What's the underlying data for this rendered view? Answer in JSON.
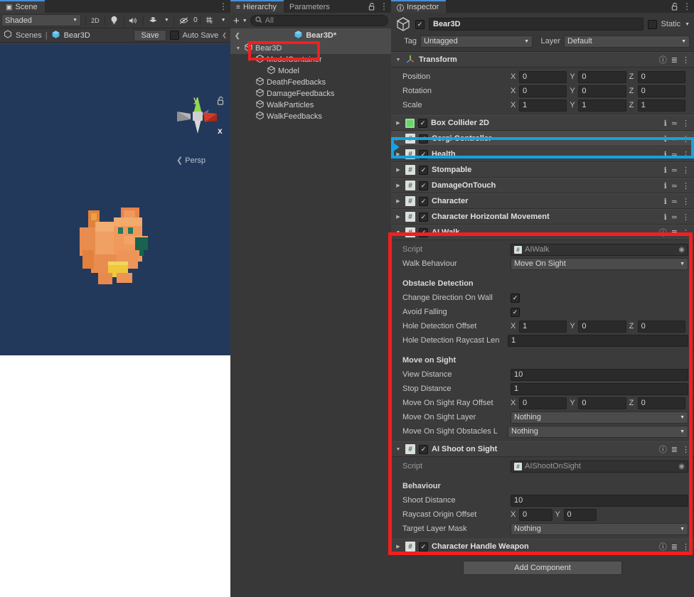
{
  "scene": {
    "tab_label": "Scene",
    "tab_icon": "grid-icon",
    "kebab": "⋮",
    "toolbar": {
      "shading_mode": "Shaded",
      "mode_2d": "2D",
      "lighting_icon": "lightbulb-icon",
      "audio_icon": "speaker-icon",
      "fx_icon": "effects-icon",
      "hidden_count": "0",
      "grid_icon": "grid-snap-icon"
    },
    "breadcrumb": {
      "scenes_label": "Scenes",
      "separator": "|",
      "scene_name": "Bear3D",
      "save_label": "Save",
      "auto_save_label": "Auto Save"
    },
    "gizmo": {
      "axis_y": "y",
      "axis_x": "x",
      "perspective_label": "Persp",
      "lock_icon": "lock-open-icon"
    },
    "background_color": "#23395b"
  },
  "hierarchy": {
    "tab_label": "Hierarchy",
    "tab_parameters": "Parameters",
    "lock_icon": "lock-open-icon",
    "kebab": "⋮",
    "create_label": "+",
    "search_placeholder": "All",
    "scene_row": "Bear3D*",
    "items": [
      {
        "label": "Bear3D",
        "indent": 0,
        "expanded": true,
        "selected": true
      },
      {
        "label": "ModelContainer",
        "indent": 1,
        "expanded": true,
        "selected": false
      },
      {
        "label": "Model",
        "indent": 2,
        "expanded": false,
        "selected": false
      },
      {
        "label": "DeathFeedbacks",
        "indent": 1,
        "expanded": false,
        "selected": false
      },
      {
        "label": "DamageFeedbacks",
        "indent": 1,
        "expanded": false,
        "selected": false
      },
      {
        "label": "WalkParticles",
        "indent": 1,
        "expanded": false,
        "selected": false
      },
      {
        "label": "WalkFeedbacks",
        "indent": 1,
        "expanded": false,
        "selected": false
      }
    ]
  },
  "inspector": {
    "tab_label": "Inspector",
    "lock_icon": "lock-open-icon",
    "kebab": "⋮",
    "object_name": "Bear3D",
    "static_label": "Static",
    "tag_label": "Tag",
    "tag_value": "Untagged",
    "layer_label": "Layer",
    "layer_value": "Default",
    "transform": {
      "title": "Transform",
      "rows": [
        {
          "label": "Position",
          "x": "0",
          "y": "0",
          "z": "0"
        },
        {
          "label": "Rotation",
          "x": "0",
          "y": "0",
          "z": "0"
        },
        {
          "label": "Scale",
          "x": "1",
          "y": "1",
          "z": "1"
        }
      ]
    },
    "components": [
      {
        "name": "Box Collider 2D",
        "icon": "collider-icon",
        "enabled": true,
        "expanded": false,
        "selected": false
      },
      {
        "name": "Corgi Controller",
        "icon": "script-icon",
        "enabled": true,
        "expanded": false,
        "selected": true
      },
      {
        "name": "Health",
        "icon": "script-icon",
        "enabled": true,
        "expanded": false,
        "selected": false
      },
      {
        "name": "Stompable",
        "icon": "script-icon",
        "enabled": true,
        "expanded": false,
        "selected": false
      },
      {
        "name": "DamageOnTouch",
        "icon": "script-icon",
        "enabled": true,
        "expanded": false,
        "selected": false
      },
      {
        "name": "Character",
        "icon": "script-icon",
        "enabled": true,
        "expanded": false,
        "selected": false
      },
      {
        "name": "Character Horizontal Movement",
        "icon": "script-icon",
        "enabled": true,
        "expanded": false,
        "selected": false
      }
    ],
    "ai_walk": {
      "title": "AI Walk",
      "enabled": true,
      "script_label": "Script",
      "script_value": "AIWalk",
      "walk_behaviour_label": "Walk Behaviour",
      "walk_behaviour_value": "Move On Sight",
      "obstacle_section": "Obstacle Detection",
      "change_direction_label": "Change Direction On Wall",
      "change_direction_value": true,
      "avoid_falling_label": "Avoid Falling",
      "avoid_falling_value": true,
      "hole_offset_label": "Hole Detection Offset",
      "hole_offset": {
        "x": "1",
        "y": "0",
        "z": "0"
      },
      "hole_raycast_label": "Hole Detection Raycast Len",
      "hole_raycast_value": "1",
      "move_section": "Move on Sight",
      "view_distance_label": "View Distance",
      "view_distance_value": "10",
      "stop_distance_label": "Stop Distance",
      "stop_distance_value": "1",
      "ray_offset_label": "Move On Sight Ray Offset",
      "ray_offset": {
        "x": "0",
        "y": "0",
        "z": "0"
      },
      "sight_layer_label": "Move On Sight Layer",
      "sight_layer_value": "Nothing",
      "obstacles_layer_label": "Move On Sight Obstacles L",
      "obstacles_layer_value": "Nothing"
    },
    "ai_shoot": {
      "title": "AI Shoot on Sight",
      "enabled": true,
      "script_label": "Script",
      "script_value": "AIShootOnSight",
      "behaviour_section": "Behaviour",
      "shoot_distance_label": "Shoot Distance",
      "shoot_distance_value": "10",
      "raycast_origin_label": "Raycast Origin Offset",
      "raycast_origin": {
        "x": "0",
        "y": "0"
      },
      "target_layer_label": "Target Layer Mask",
      "target_layer_value": "Nothing"
    },
    "trailing_component": {
      "name": "Character Handle Weapon",
      "icon": "script-icon",
      "enabled": true
    },
    "add_component_label": "Add Component",
    "help_icon": "help-icon",
    "preset_icon": "preset-icon",
    "menu_icon": "kebab-icon"
  },
  "annotations": {
    "red_color": "#f41e1e",
    "blue_color": "#14a3e0",
    "hierarchy_highlight_target": "Bear3D",
    "blue_highlight_target": "Corgi Controller",
    "red_highlight_target": "AI Walk / AI Shoot on Sight"
  }
}
